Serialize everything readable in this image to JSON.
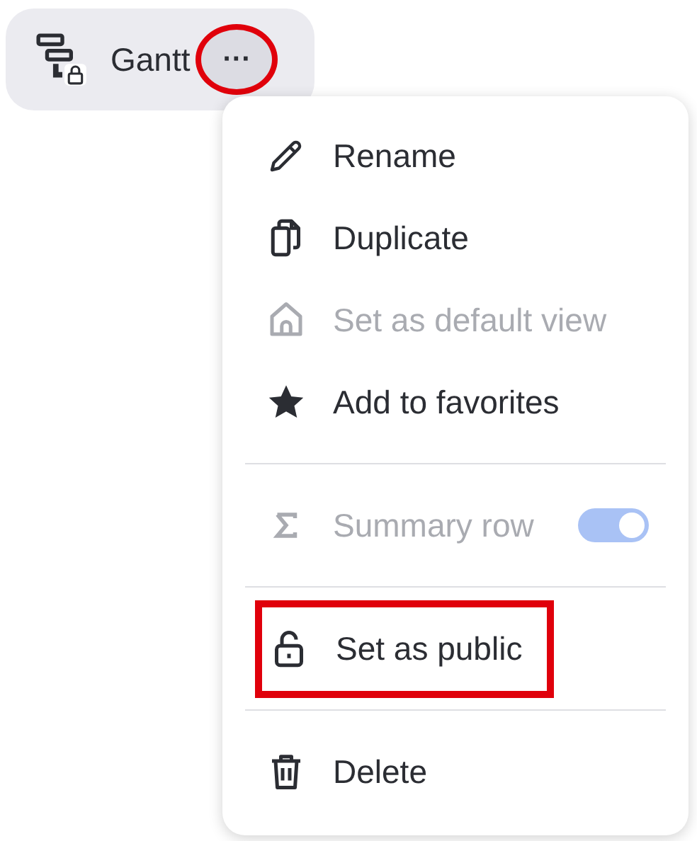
{
  "view_tab": {
    "label": "Gantt",
    "more_button": {
      "label": "···",
      "highlighted": true
    }
  },
  "menu": {
    "sections": [
      {
        "items": [
          {
            "kind": "action",
            "label": "Rename",
            "disabled": false,
            "highlighted": false
          },
          {
            "kind": "action",
            "label": "Duplicate",
            "disabled": false,
            "highlighted": false
          },
          {
            "kind": "action",
            "label": "Set as default view",
            "disabled": true,
            "highlighted": false
          },
          {
            "kind": "action",
            "label": "Add to favorites",
            "disabled": false,
            "highlighted": false
          }
        ]
      },
      {
        "items": [
          {
            "kind": "toggle",
            "label": "Summary row",
            "disabled": true,
            "on": true,
            "highlighted": false
          }
        ]
      },
      {
        "items": [
          {
            "kind": "action",
            "label": "Set as public",
            "disabled": false,
            "highlighted": true
          }
        ]
      },
      {
        "items": [
          {
            "kind": "action",
            "label": "Delete",
            "disabled": false,
            "highlighted": false
          }
        ]
      }
    ]
  }
}
